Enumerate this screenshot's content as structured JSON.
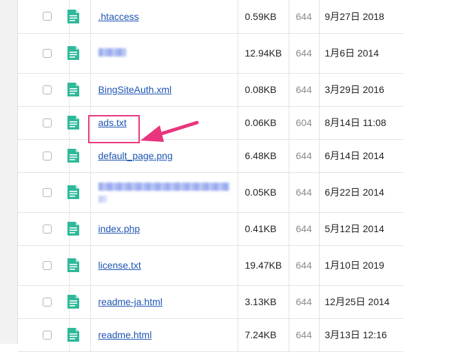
{
  "files": [
    {
      "name": ".htaccess",
      "obscured": false,
      "size": "0.59KB",
      "size_wrapped": false,
      "perm": "644",
      "date": "9月27日 2018"
    },
    {
      "name": "",
      "obscured": true,
      "size": "12.94KB",
      "size_wrapped": true,
      "perm": "644",
      "date": "1月6日 2014"
    },
    {
      "name": "BingSiteAuth.xml",
      "obscured": false,
      "size": "0.08KB",
      "size_wrapped": false,
      "perm": "644",
      "date": "3月29日 2016"
    },
    {
      "name": "ads.txt",
      "obscured": false,
      "size": "0.06KB",
      "size_wrapped": false,
      "perm": "604",
      "date": "8月14日 11:08",
      "highlighted": true
    },
    {
      "name": "default_page.png",
      "obscured": false,
      "size": "6.48KB",
      "size_wrapped": false,
      "perm": "644",
      "date": "6月14日 2014"
    },
    {
      "name": "",
      "obscured": true,
      "size": "0.05KB",
      "size_wrapped": false,
      "perm": "644",
      "date": "6月22日 2014"
    },
    {
      "name": "index.php",
      "obscured": false,
      "size": "0.41KB",
      "size_wrapped": false,
      "perm": "644",
      "date": "5月12日 2014"
    },
    {
      "name": "license.txt",
      "obscured": false,
      "size": "19.47KB",
      "size_wrapped": true,
      "perm": "644",
      "date": "1月10日 2019"
    },
    {
      "name": "readme-ja.html",
      "obscured": false,
      "size": "3.13KB",
      "size_wrapped": false,
      "perm": "644",
      "date": "12月25日 2014"
    },
    {
      "name": "readme.html",
      "obscured": false,
      "size": "7.24KB",
      "size_wrapped": false,
      "perm": "644",
      "date": "3月13日 12:16"
    }
  ],
  "colors": {
    "link": "#1e54b3",
    "icon": "#2fb89a",
    "annotation": "#e8357d",
    "permission_text": "#8a8a8a"
  },
  "icons": {
    "file": "file-document-icon",
    "annotation": "arrow-pointer-icon"
  }
}
